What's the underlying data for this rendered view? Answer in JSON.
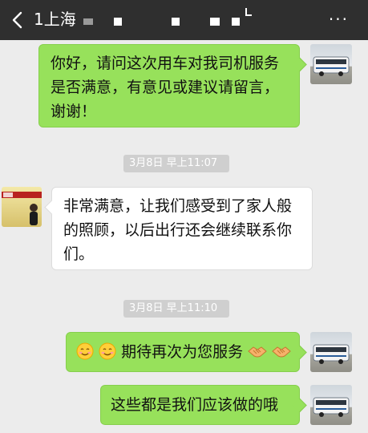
{
  "header": {
    "title": "1上海",
    "back_icon": "chevron-left-icon",
    "more_label": "···",
    "background": "#2f2f2f"
  },
  "messages": [
    {
      "side": "right",
      "text": "你好，请问这次用车对我司机服务是否满意，有意见或建议请留言，谢谢！"
    },
    {
      "side": "left",
      "text": "非常满意，让我们感受到了家人般的照顾，以后出行还会继续联系你们。"
    },
    {
      "side": "right",
      "text": "期待再次为您服务",
      "emoji_before": [
        "smiling-face-icon",
        "smiling-face-icon"
      ],
      "emoji_after": [
        "handshake-icon",
        "handshake-icon"
      ]
    },
    {
      "side": "right",
      "text": "这些都是我们应该做的哦"
    }
  ],
  "timestamps": [
    {
      "text": "3月8日 早上11:07"
    },
    {
      "text": "3月8日 早上11:10"
    }
  ],
  "colors": {
    "chat_background": "#ececec",
    "bubble_sent": "#97e15b",
    "bubble_received": "#ffffff",
    "timestamp_background": "#cfcfcf"
  }
}
